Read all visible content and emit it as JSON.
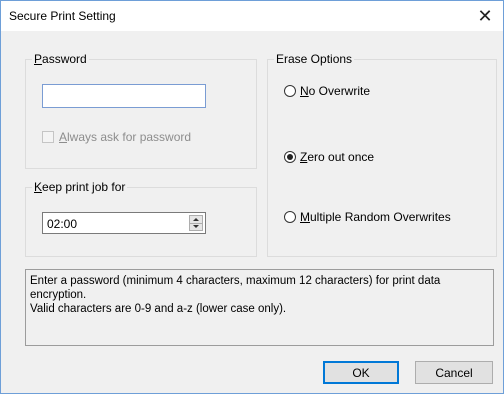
{
  "dialog": {
    "title": "Secure Print Setting",
    "close_glyph": "✕"
  },
  "password_group": {
    "legend_accel": "P",
    "legend_rest": "assword",
    "value": "",
    "always_ask": {
      "accel": "A",
      "rest": "lways ask for password",
      "checked": false,
      "enabled": false
    }
  },
  "keep_group": {
    "legend_accel": "K",
    "legend_rest": "eep print job for",
    "value": "02:00"
  },
  "erase_group": {
    "legend": "Erase Options",
    "options": [
      {
        "accel": "N",
        "rest": "o Overwrite",
        "selected": false
      },
      {
        "accel": "Z",
        "rest": "ero out once",
        "selected": true
      },
      {
        "accel": "M",
        "rest": "ultiple Random Overwrites",
        "selected": false
      }
    ]
  },
  "info": {
    "line1": "Enter a password (minimum 4 characters, maximum 12 characters) for print data encryption.",
    "line2": "Valid characters are 0-9 and a-z (lower case only)."
  },
  "buttons": {
    "ok": "OK",
    "cancel": "Cancel"
  },
  "colors": {
    "accent": "#0078d7",
    "border_blue": "#6e9fd8"
  }
}
